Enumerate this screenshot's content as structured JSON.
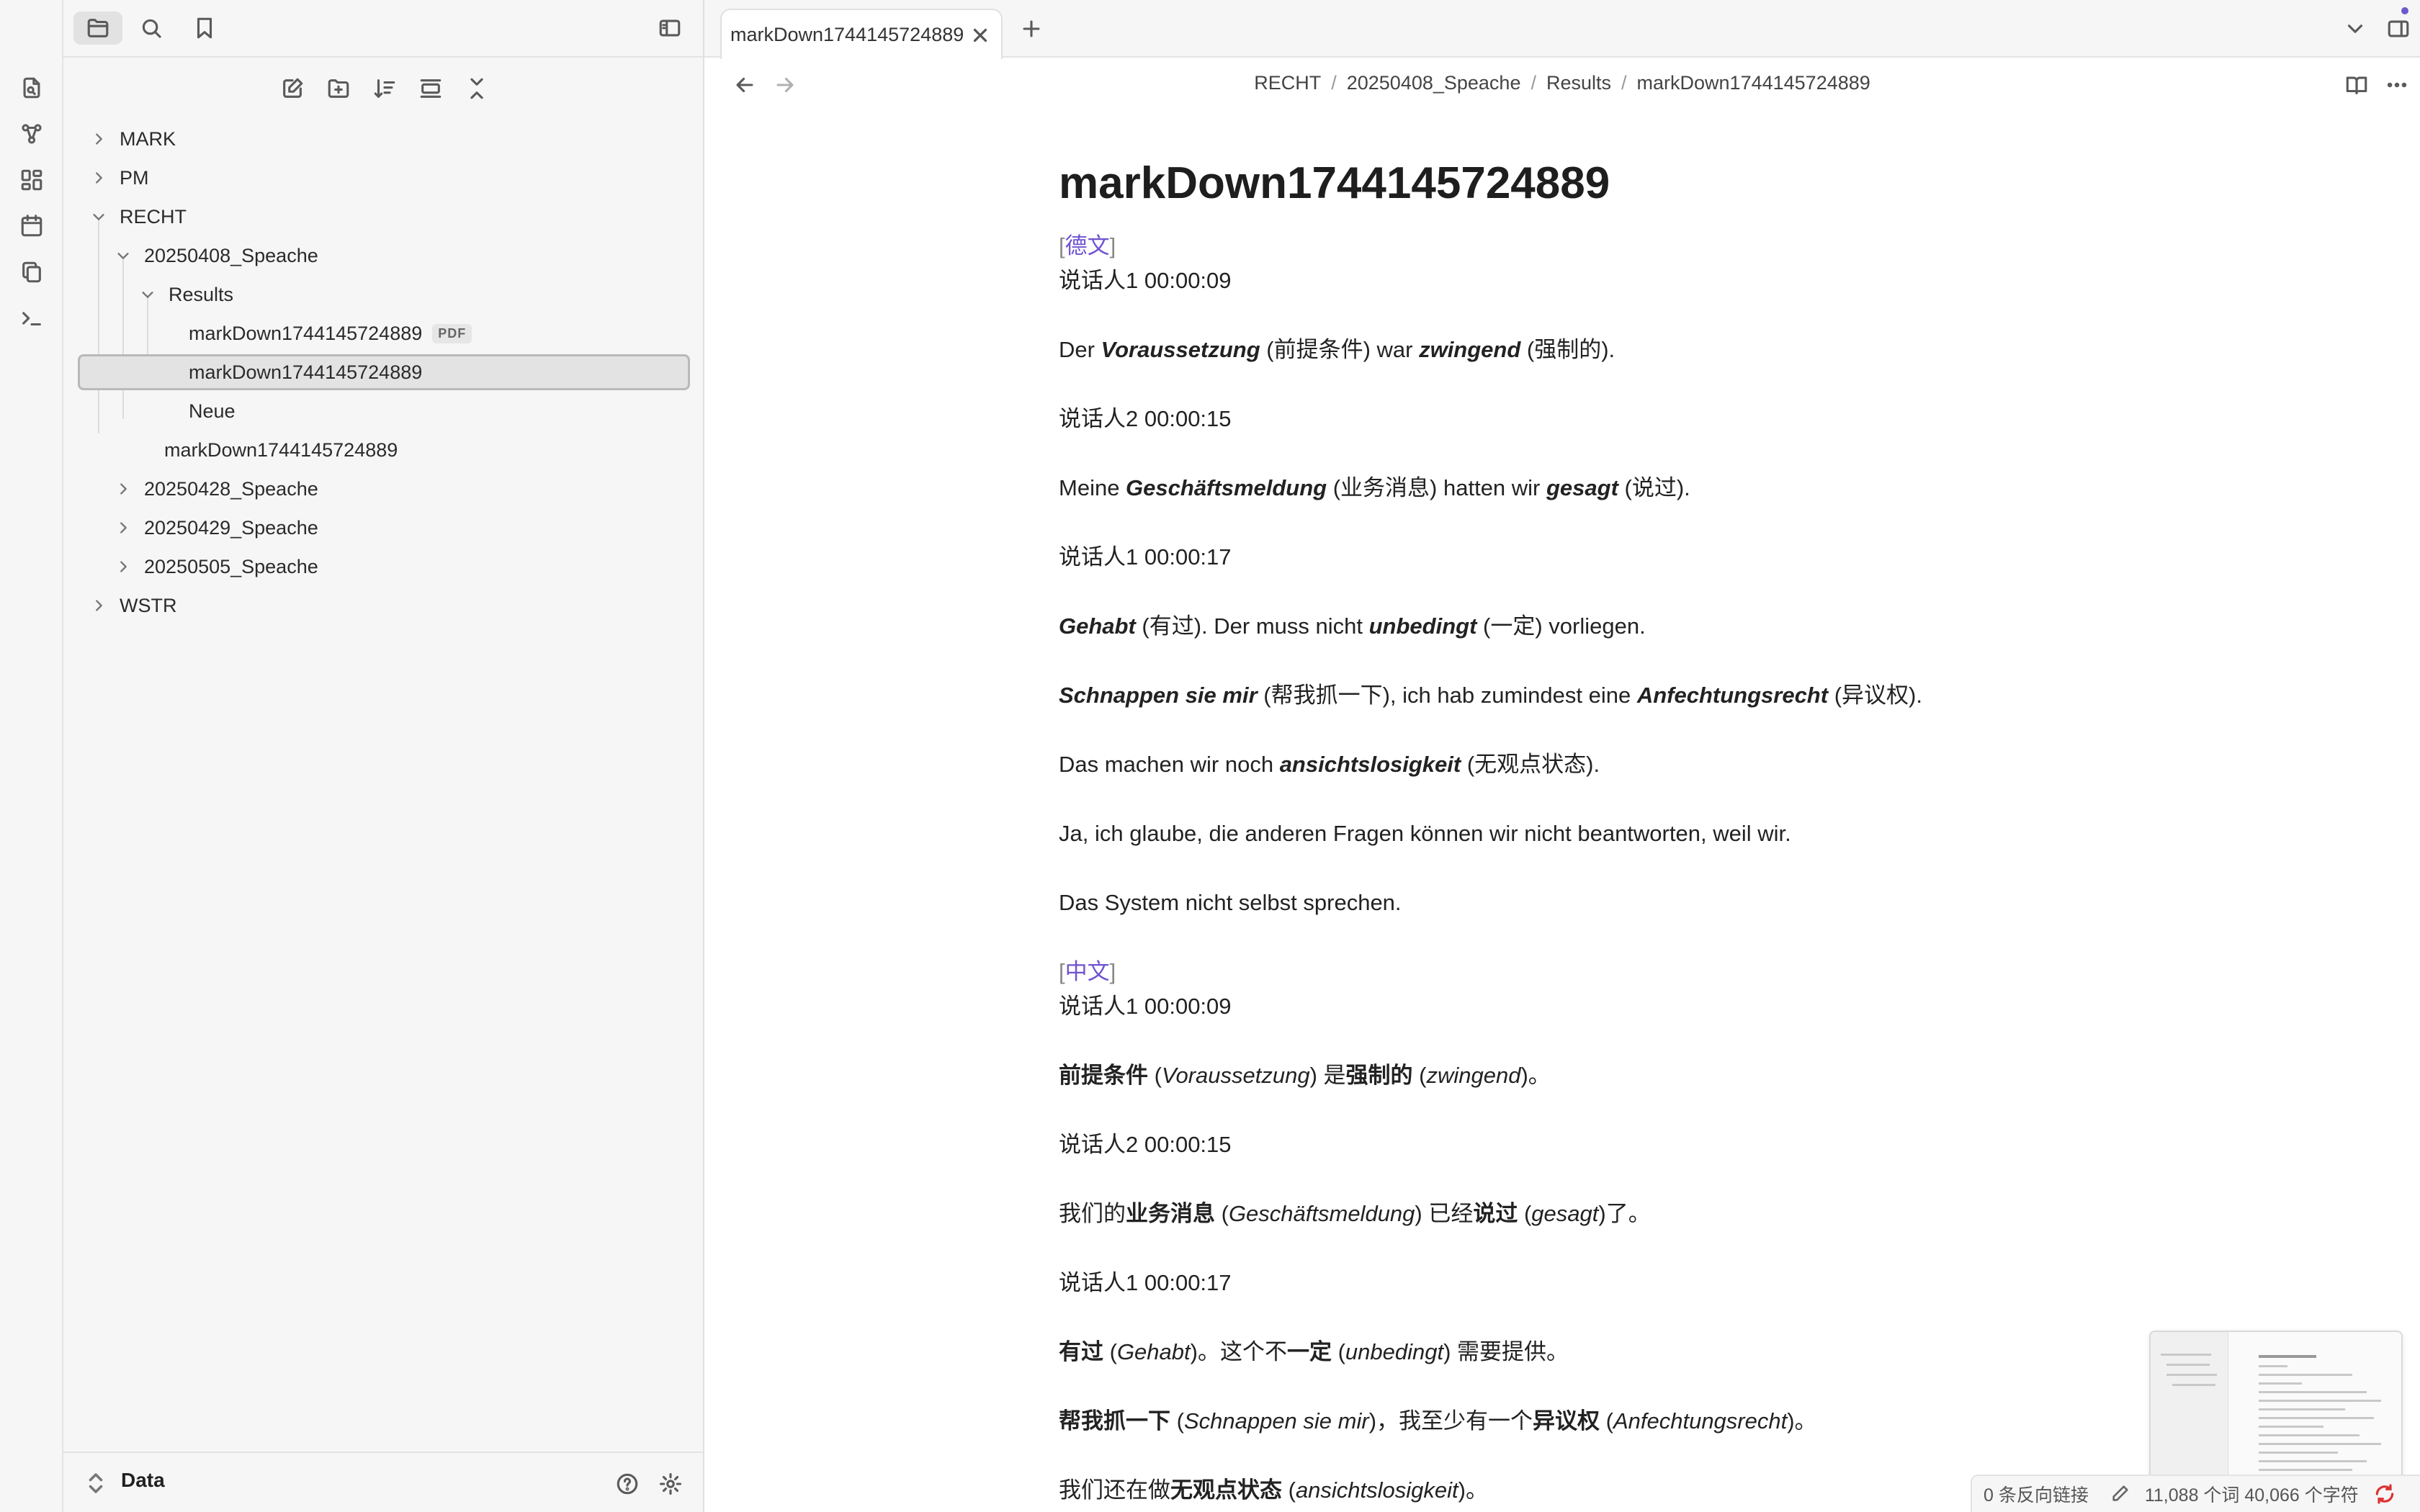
{
  "ribbon": {
    "items": [
      {
        "name": "open-quick-switcher-icon"
      },
      {
        "name": "graph-view-icon"
      },
      {
        "name": "canvas-icon"
      },
      {
        "name": "daily-note-icon"
      },
      {
        "name": "templates-icon"
      },
      {
        "name": "command-palette-icon"
      }
    ]
  },
  "sidebar": {
    "top_buttons": [
      "files-icon",
      "search-icon",
      "bookmarks-icon"
    ],
    "toggle_icon": "sidebar-toggle-icon",
    "nav_actions": [
      "new-note-icon",
      "new-folder-icon",
      "sort-icon",
      "auto-reveal-icon",
      "collapse-all-icon"
    ],
    "tree": {
      "mark": "MARK",
      "pm": "PM",
      "recht": "RECHT",
      "f20250408": "20250408_Speache",
      "results": "Results",
      "file_pdf": "markDown1744145724889",
      "pdf_badge": "PDF",
      "file_md_selected": "markDown1744145724889",
      "neue": "Neue",
      "file_md2": "markDown1744145724889",
      "f20250428": "20250428_Speache",
      "f20250429": "20250429_Speache",
      "f20250505": "20250505_Speache",
      "wstr": "WSTR"
    },
    "footer": {
      "vault": "Data",
      "help_icon": "help-icon",
      "settings_icon": "settings-icon"
    }
  },
  "tabs": {
    "active_title": "markDown1744145724889"
  },
  "breadcrumb": [
    "RECHT",
    "20250408_Speache",
    "Results",
    "markDown1744145724889"
  ],
  "doc": {
    "title": "markDown1744145724889",
    "tag_de": "德文",
    "tag_zh": "中文",
    "de": {
      "s1": "说话人1 00:00:09",
      "l1": [
        "Der ",
        "Voraussetzung",
        " (前提条件) war ",
        "zwingend",
        " (强制的)."
      ],
      "s2": "说话人2 00:00:15",
      "l2": [
        "Meine ",
        "Geschäftsmeldung",
        " (业务消息) hatten wir ",
        "gesagt",
        " (说过)."
      ],
      "s3": "说话人1 00:00:17",
      "l3": [
        "Gehabt",
        " (有过). Der muss nicht ",
        "unbedingt",
        " (一定) vorliegen."
      ],
      "l4": [
        "Schnappen sie mir",
        " (帮我抓一下), ich hab zumindest eine ",
        "Anfechtungsrecht",
        " (异议权)."
      ],
      "l5": [
        "Das machen wir noch ",
        "ansichtslosigkeit",
        " (无观点状态)."
      ],
      "l6": "Ja, ich glaube, die anderen Fragen können wir nicht beantworten, weil wir.",
      "l7": "Das System nicht selbst sprechen."
    },
    "zh": {
      "s1": "说话人1 00:00:09",
      "l1": [
        "前提条件",
        " (",
        "Voraussetzung",
        ") 是",
        "强制的",
        " (",
        "zwingend",
        ")。"
      ],
      "s2": "说话人2 00:00:15",
      "l2": [
        "我们的",
        "业务消息",
        " (",
        "Geschäftsmeldung",
        ") 已经",
        "说过",
        " (",
        "gesagt",
        ")了。"
      ],
      "s3": "说话人1 00:00:17",
      "l3": [
        "有过",
        " (",
        "Gehabt",
        ")。这个不",
        "一定",
        " (",
        "unbedingt",
        ") 需要提供。"
      ],
      "l4": [
        "帮我抓一下",
        " (",
        "Schnappen sie mir",
        ")，我至少有一个",
        "异议权",
        " (",
        "Anfechtungsrecht",
        ")。"
      ],
      "l5": [
        "我们还在做",
        "无观点状态",
        " (",
        "ansichtslosigkeit",
        ")。"
      ]
    }
  },
  "status": {
    "backlinks": "0 条反向链接",
    "counts": "11,088 个词 40,066 个字符"
  },
  "colors": {
    "accent": "#7052d1",
    "sidebar_bg": "#f6f6f6",
    "selected_bg": "#e3e3e3"
  }
}
